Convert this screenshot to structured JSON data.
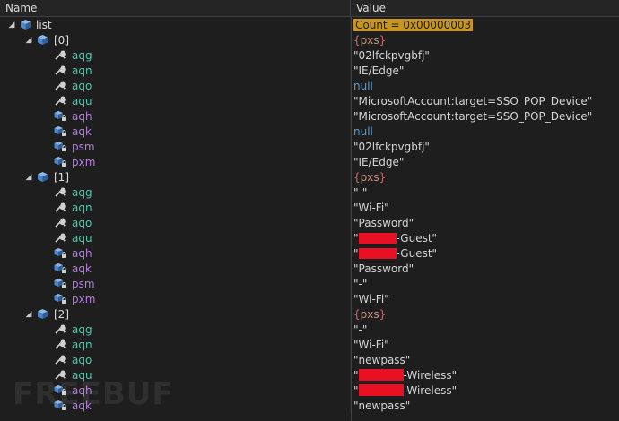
{
  "header": {
    "name_col": "Name",
    "value_col": "Value"
  },
  "root": {
    "name": "list",
    "value": "Count = 0x00000003"
  },
  "groups": [
    {
      "index": "[0]",
      "value": "{pxs}",
      "items": [
        {
          "name": "aqg",
          "kind": "field",
          "icon": "wrench-icon",
          "value": "\"02lfckpvgbfj\"",
          "vtype": "str"
        },
        {
          "name": "aqn",
          "kind": "field",
          "icon": "wrench-icon",
          "value": "\"IE/Edge\"",
          "vtype": "str"
        },
        {
          "name": "aqo",
          "kind": "field",
          "icon": "wrench-icon",
          "value": "null",
          "vtype": "null"
        },
        {
          "name": "aqu",
          "kind": "field",
          "icon": "wrench-icon",
          "value": "\"MicrosoftAccount:target=SSO_POP_Device\"",
          "vtype": "str"
        },
        {
          "name": "aqh",
          "kind": "prop",
          "icon": "property-icon",
          "value": "\"MicrosoftAccount:target=SSO_POP_Device\"",
          "vtype": "str"
        },
        {
          "name": "aqk",
          "kind": "prop",
          "icon": "property-icon",
          "value": "null",
          "vtype": "null"
        },
        {
          "name": "psm",
          "kind": "prop",
          "icon": "property-icon",
          "value": "\"02lfckpvgbfj\"",
          "vtype": "str"
        },
        {
          "name": "pxm",
          "kind": "prop",
          "icon": "property-icon",
          "value": "\"IE/Edge\"",
          "vtype": "str"
        }
      ]
    },
    {
      "index": "[1]",
      "value": "{pxs}",
      "items": [
        {
          "name": "aqg",
          "kind": "field",
          "icon": "wrench-icon",
          "value": "\"-\"",
          "vtype": "str"
        },
        {
          "name": "aqn",
          "kind": "field",
          "icon": "wrench-icon",
          "value": "\"Wi-Fi\"",
          "vtype": "str"
        },
        {
          "name": "aqo",
          "kind": "field",
          "icon": "wrench-icon",
          "value": "\"Password\"",
          "vtype": "str"
        },
        {
          "name": "aqu",
          "kind": "field",
          "icon": "wrench-icon",
          "value": "-Guest\"",
          "vtype": "redact",
          "prefix": "\""
        },
        {
          "name": "aqh",
          "kind": "prop",
          "icon": "property-icon",
          "value": "-Guest\"",
          "vtype": "redact",
          "prefix": "\""
        },
        {
          "name": "aqk",
          "kind": "prop",
          "icon": "property-icon",
          "value": "\"Password\"",
          "vtype": "str"
        },
        {
          "name": "psm",
          "kind": "prop",
          "icon": "property-icon",
          "value": "\"-\"",
          "vtype": "str"
        },
        {
          "name": "pxm",
          "kind": "prop",
          "icon": "property-icon",
          "value": "\"Wi-Fi\"",
          "vtype": "str"
        }
      ]
    },
    {
      "index": "[2]",
      "value": "{pxs}",
      "items": [
        {
          "name": "aqg",
          "kind": "field",
          "icon": "wrench-icon",
          "value": "\"-\"",
          "vtype": "str"
        },
        {
          "name": "aqn",
          "kind": "field",
          "icon": "wrench-icon",
          "value": "\"Wi-Fi\"",
          "vtype": "str"
        },
        {
          "name": "aqo",
          "kind": "field",
          "icon": "wrench-icon",
          "value": "\"newpass\"",
          "vtype": "str"
        },
        {
          "name": "aqu",
          "kind": "field",
          "icon": "wrench-icon",
          "value": "-Wireless\"",
          "vtype": "redact",
          "prefix": "\""
        },
        {
          "name": "aqh",
          "kind": "prop",
          "icon": "property-icon",
          "value": "-Wireless\"",
          "vtype": "redact",
          "prefix": "\""
        },
        {
          "name": "aqk",
          "kind": "prop",
          "icon": "property-icon",
          "value": "\"newpass\"",
          "vtype": "str"
        }
      ]
    }
  ],
  "watermark": "FREEBUF",
  "colors": {
    "background": "#1e1e1e",
    "field": "#4ec9b0",
    "property": "#b57edc",
    "null": "#569cd6",
    "count_highlight": "#c8961f",
    "redaction": "#e81123"
  }
}
